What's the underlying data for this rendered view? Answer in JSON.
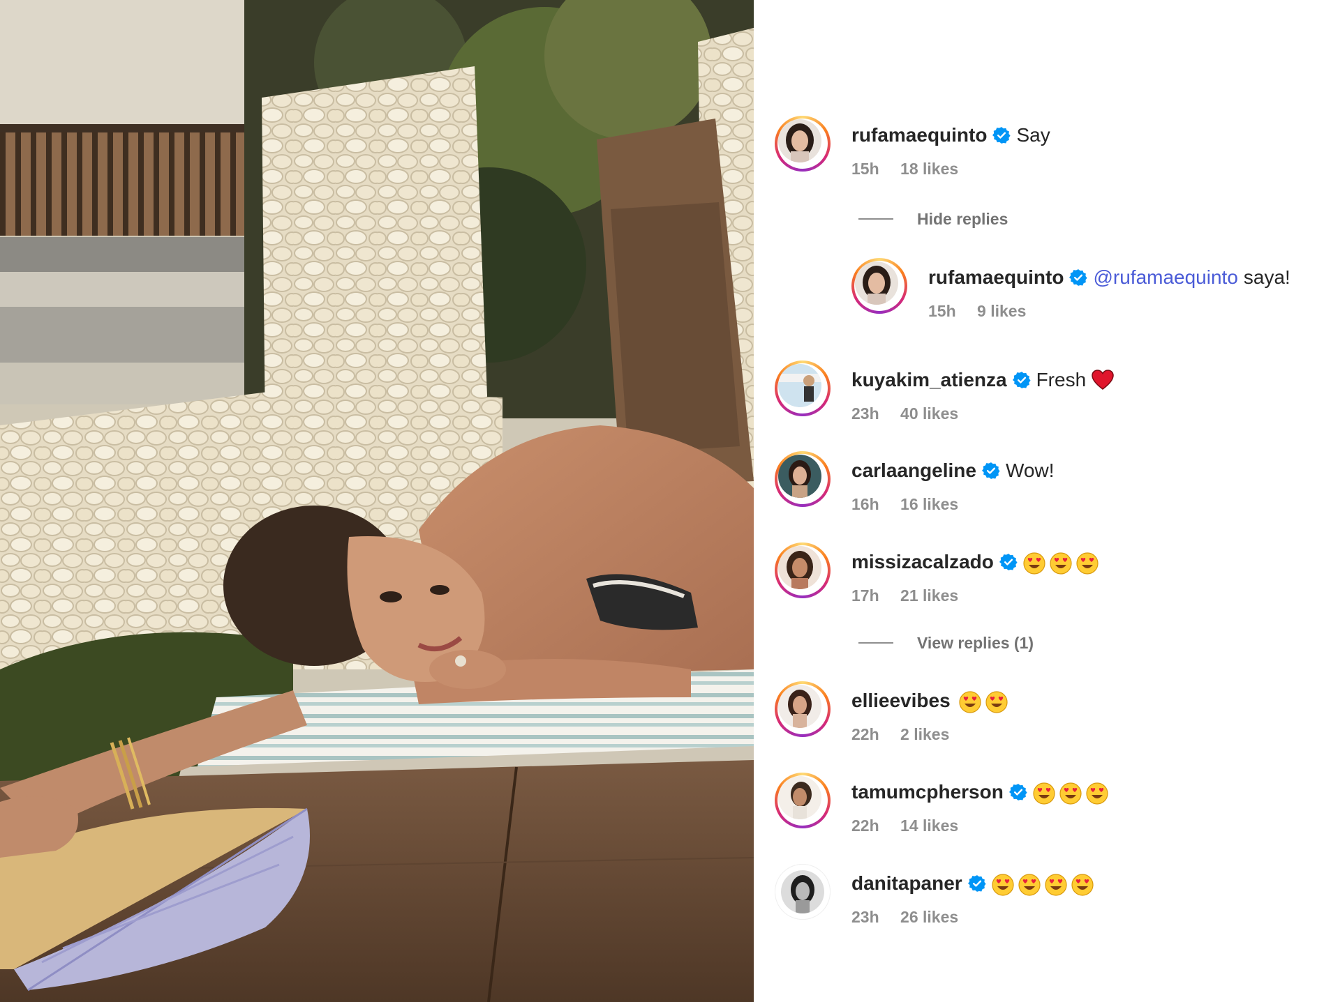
{
  "colors": {
    "username": "#262626",
    "meta": "#8e8e8e",
    "mention": "#4a5bd7",
    "verified": "#0095f6"
  },
  "photo": {
    "icon": "beach-lounge-photo"
  },
  "comments": [
    {
      "username": "rufamaequinto",
      "verified": true,
      "text": "Say",
      "time": "15h",
      "likes": "18 likes",
      "toggle": "Hide replies",
      "replies": [
        {
          "username": "rufamaequinto",
          "verified": true,
          "mention": "@rufamaequinto",
          "text": "saya!",
          "time": "15h",
          "likes": "9 likes"
        }
      ]
    },
    {
      "username": "kuyakim_atienza",
      "verified": true,
      "text": "Fresh",
      "emoji": [
        "red-heart"
      ],
      "time": "23h",
      "likes": "40 likes"
    },
    {
      "username": "carlaangeline",
      "verified": true,
      "text": "Wow!",
      "time": "16h",
      "likes": "16 likes"
    },
    {
      "username": "missizacalzado",
      "verified": true,
      "emoji": [
        "heart-eyes",
        "heart-eyes",
        "heart-eyes"
      ],
      "time": "17h",
      "likes": "21 likes",
      "toggle": "View replies (1)"
    },
    {
      "username": "ellieevibes",
      "verified": false,
      "emoji": [
        "heart-eyes",
        "heart-eyes"
      ],
      "time": "22h",
      "likes": "2 likes"
    },
    {
      "username": "tamumcpherson",
      "verified": true,
      "emoji": [
        "heart-eyes",
        "heart-eyes",
        "heart-eyes"
      ],
      "time": "22h",
      "likes": "14 likes"
    },
    {
      "username": "danitapaner",
      "verified": true,
      "emoji": [
        "heart-eyes",
        "heart-eyes",
        "heart-eyes",
        "heart-eyes"
      ],
      "time": "23h",
      "likes": "26 likes"
    }
  ]
}
